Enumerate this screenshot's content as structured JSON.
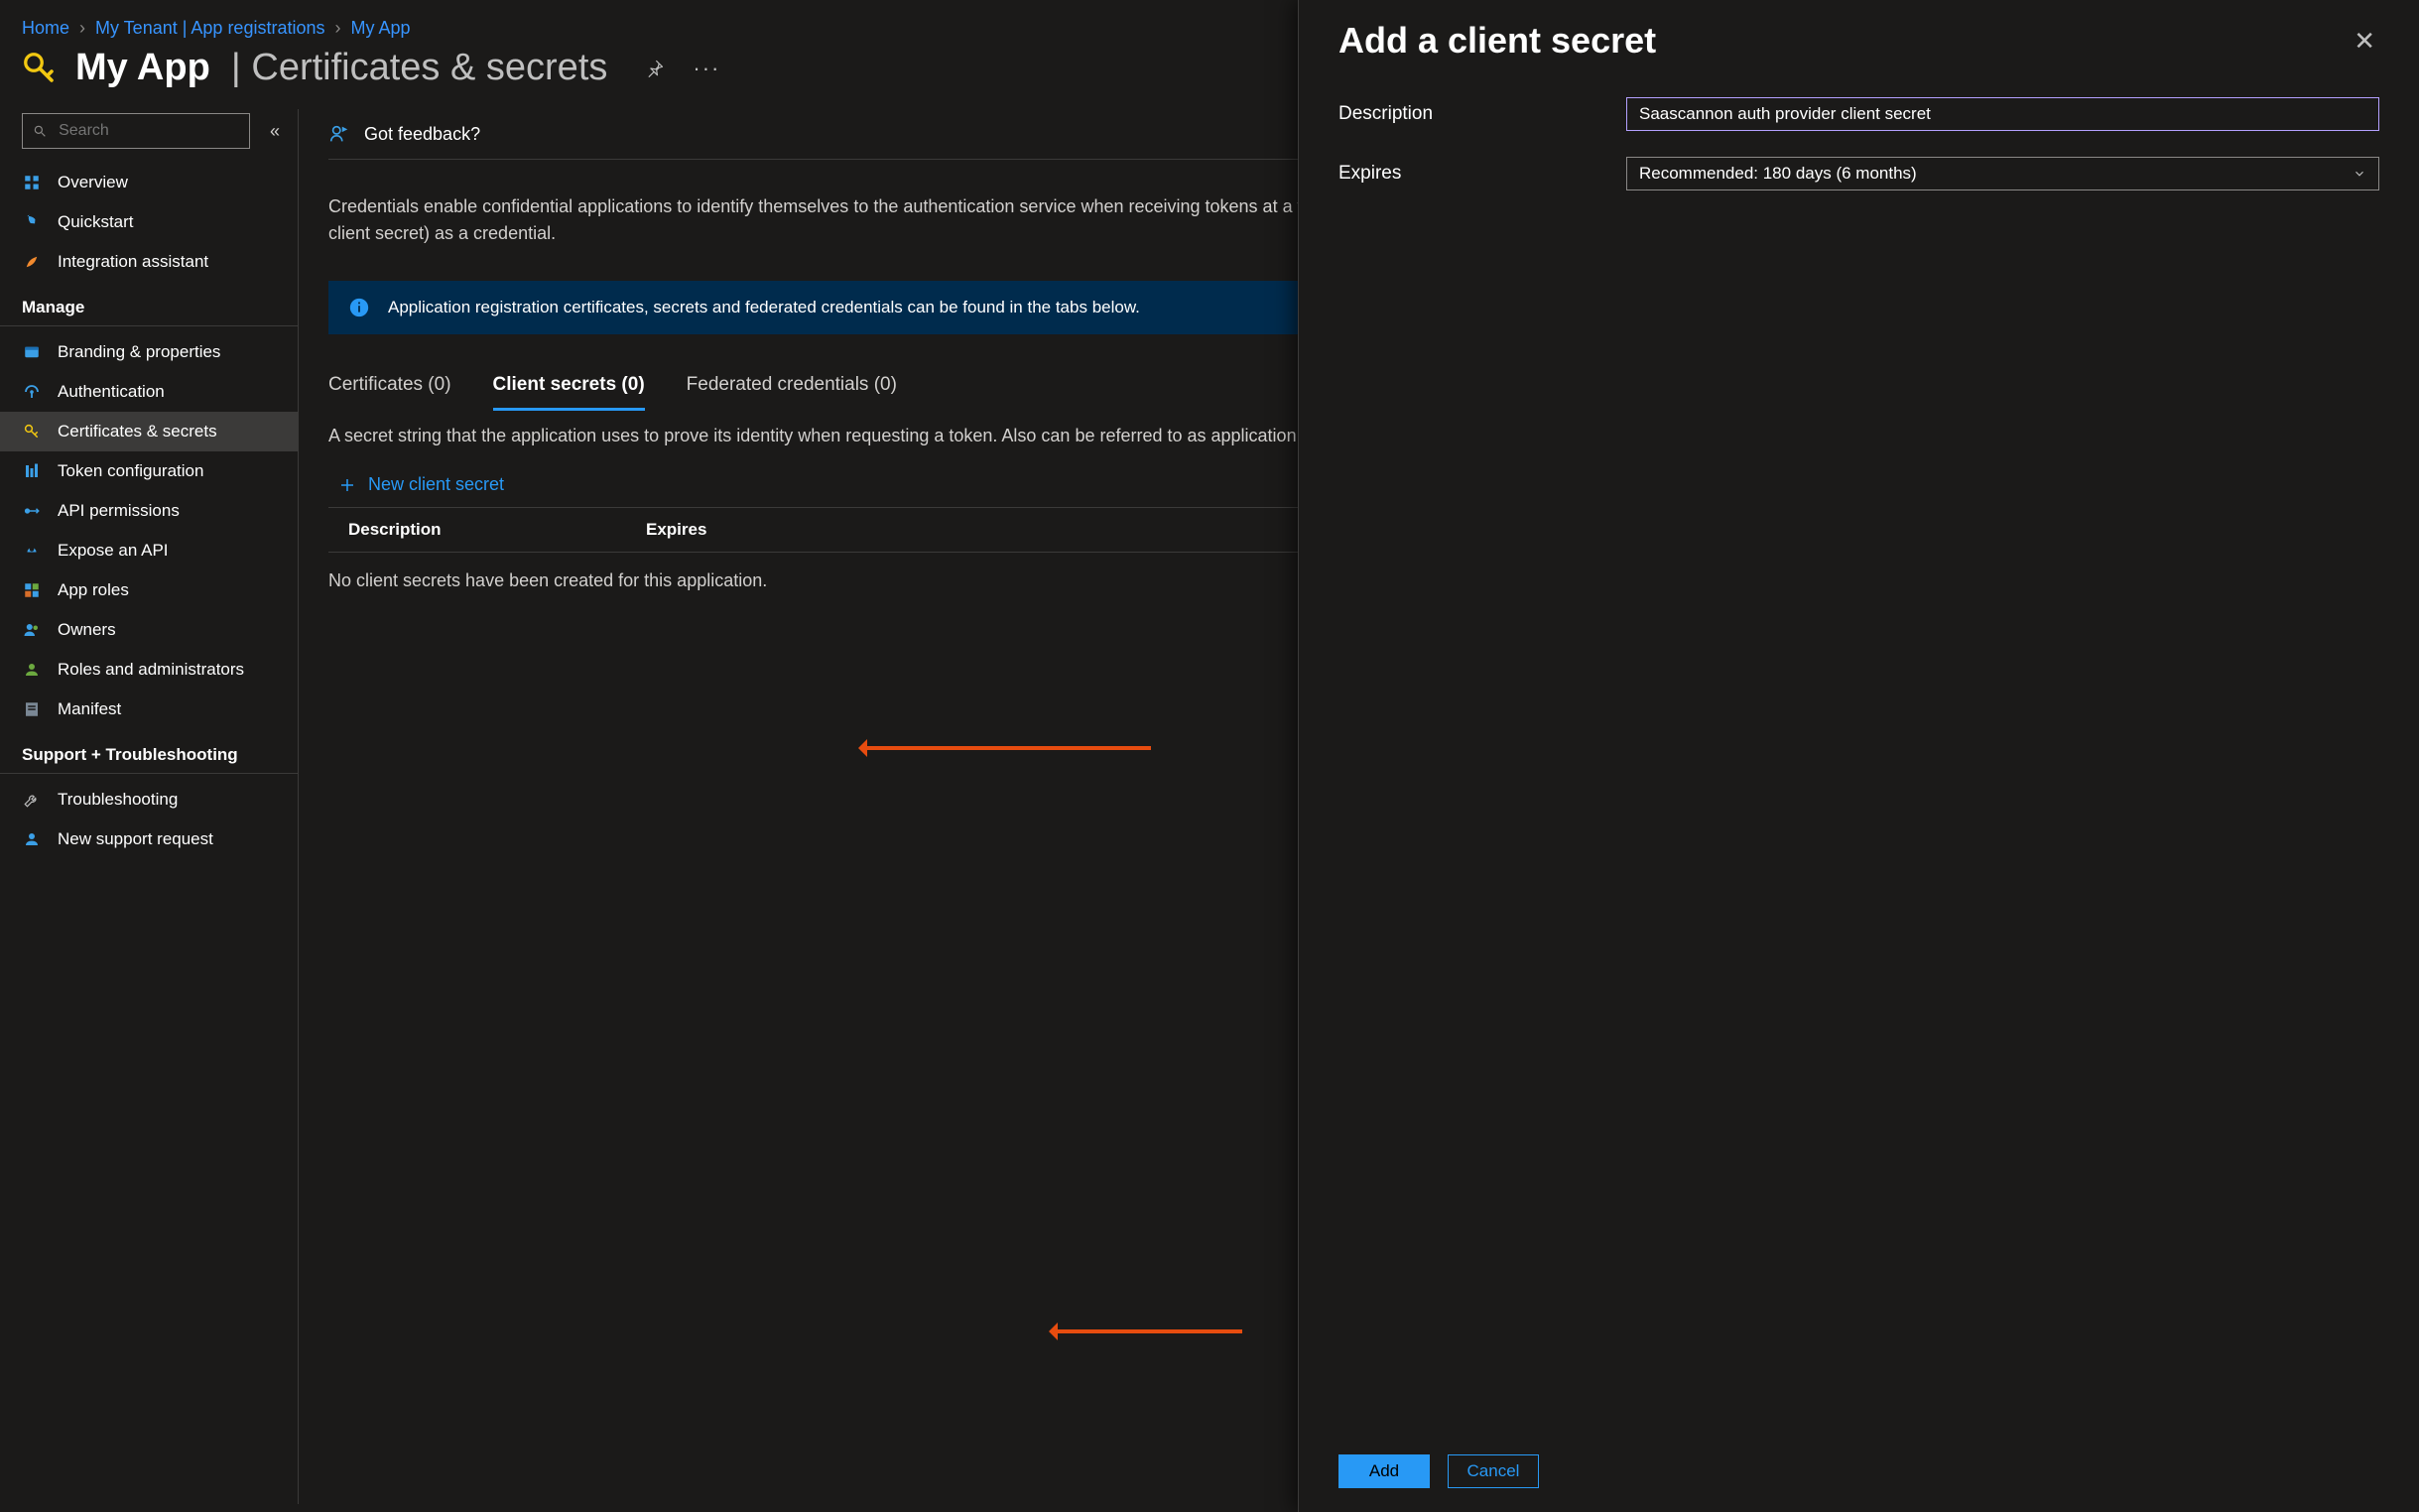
{
  "breadcrumbs": [
    "Home",
    "My Tenant | App registrations",
    "My App"
  ],
  "page": {
    "app_name": "My App",
    "section_title": "Certificates & secrets"
  },
  "search": {
    "placeholder": "Search"
  },
  "sidebar": {
    "top_items": [
      {
        "label": "Overview"
      },
      {
        "label": "Quickstart"
      },
      {
        "label": "Integration assistant"
      }
    ],
    "sections": [
      {
        "title": "Manage",
        "items": [
          {
            "label": "Branding & properties"
          },
          {
            "label": "Authentication"
          },
          {
            "label": "Certificates & secrets",
            "active": true
          },
          {
            "label": "Token configuration"
          },
          {
            "label": "API permissions"
          },
          {
            "label": "Expose an API"
          },
          {
            "label": "App roles"
          },
          {
            "label": "Owners"
          },
          {
            "label": "Roles and administrators"
          },
          {
            "label": "Manifest"
          }
        ]
      },
      {
        "title": "Support + Troubleshooting",
        "items": [
          {
            "label": "Troubleshooting"
          },
          {
            "label": "New support request"
          }
        ]
      }
    ]
  },
  "content": {
    "feedback_label": "Got feedback?",
    "intro_text": "Credentials enable confidential applications to identify themselves to the authentication service when receiving tokens at a web addressable location (using an HTTPS scheme). For a higher level of assurance, we recommend using a certificate (instead of a client secret) as a credential.",
    "info_banner": "Application registration certificates, secrets and federated credentials can be found in the tabs below.",
    "tabs": [
      {
        "label": "Certificates (0)"
      },
      {
        "label": "Client secrets (0)",
        "active": true
      },
      {
        "label": "Federated credentials (0)"
      }
    ],
    "tab_description": "A secret string that the application uses to prove its identity when requesting a token. Also can be referred to as application password.",
    "new_secret_label": "New client secret",
    "table_headers": {
      "description": "Description",
      "expires": "Expires"
    },
    "empty_message": "No client secrets have been created for this application."
  },
  "flyout": {
    "title": "Add a client secret",
    "description_label": "Description",
    "description_value": "Saascannon auth provider client secret",
    "expires_label": "Expires",
    "expires_value": "Recommended: 180 days (6 months)",
    "add_label": "Add",
    "cancel_label": "Cancel"
  }
}
